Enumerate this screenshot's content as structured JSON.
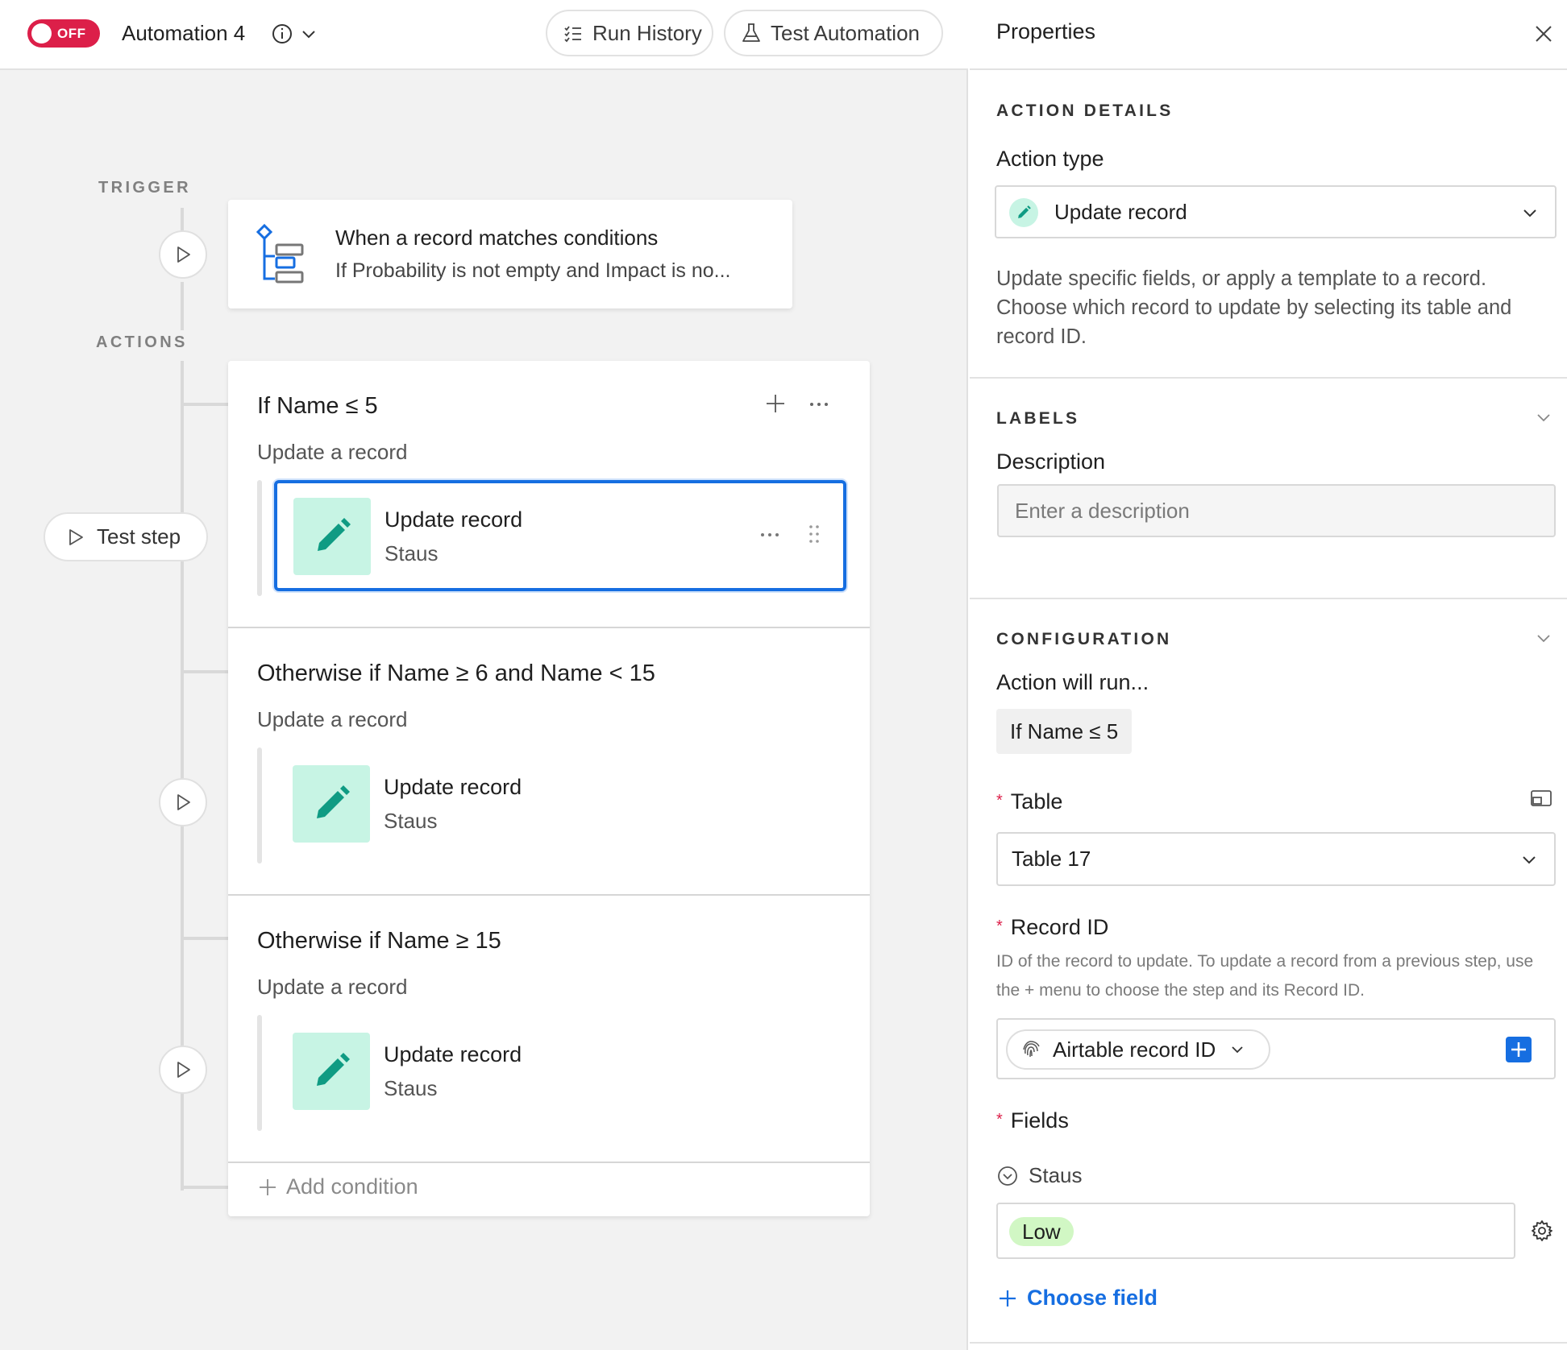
{
  "header": {
    "toggle_label": "OFF",
    "automation_name": "Automation 4",
    "run_history_label": "Run History",
    "test_automation_label": "Test Automation"
  },
  "canvas": {
    "trigger_label": "TRIGGER",
    "actions_label": "ACTIONS",
    "test_step_label": "Test step",
    "trigger": {
      "title": "When a record matches conditions",
      "subtitle": "If Probability is not empty and Impact is no..."
    },
    "branches": [
      {
        "title": "If Name ≤ 5",
        "subtitle": "Update a record",
        "step_title": "Update record",
        "step_subtitle": "Staus"
      },
      {
        "title": "Otherwise if Name ≥ 6 and Name < 15",
        "subtitle": "Update a record",
        "step_title": "Update record",
        "step_subtitle": "Staus"
      },
      {
        "title": "Otherwise if Name ≥ 15",
        "subtitle": "Update a record",
        "step_title": "Update record",
        "step_subtitle": "Staus"
      }
    ],
    "add_condition_label": "Add condition"
  },
  "properties": {
    "title": "Properties",
    "action_details": {
      "section_label": "ACTION DETAILS",
      "action_type_label": "Action type",
      "action_type_value": "Update record",
      "help_text": "Update specific fields, or apply a template to a record. Choose which record to update by selecting its table and record ID."
    },
    "labels": {
      "section_label": "LABELS",
      "description_label": "Description",
      "description_placeholder": "Enter a description"
    },
    "configuration": {
      "section_label": "CONFIGURATION",
      "action_will_run_label": "Action will run...",
      "condition_chip": "If Name ≤ 5",
      "table_label": "Table",
      "table_value": "Table 17",
      "record_id_label": "Record ID",
      "record_id_help": "ID of the record to update. To update a record from a previous step, use the + menu to choose the step and its Record ID.",
      "record_id_pill": "Airtable record ID",
      "fields_label": "Fields",
      "field_name": "Staus",
      "field_value": "Low",
      "choose_field_label": "Choose field"
    }
  },
  "colors": {
    "accent_blue": "#166ee1",
    "toggle_red": "#dc1f49",
    "step_icon_bg": "#c7f4e4",
    "step_icon_fg": "#0f9b83",
    "low_chip_bg": "#d1f7c4"
  }
}
